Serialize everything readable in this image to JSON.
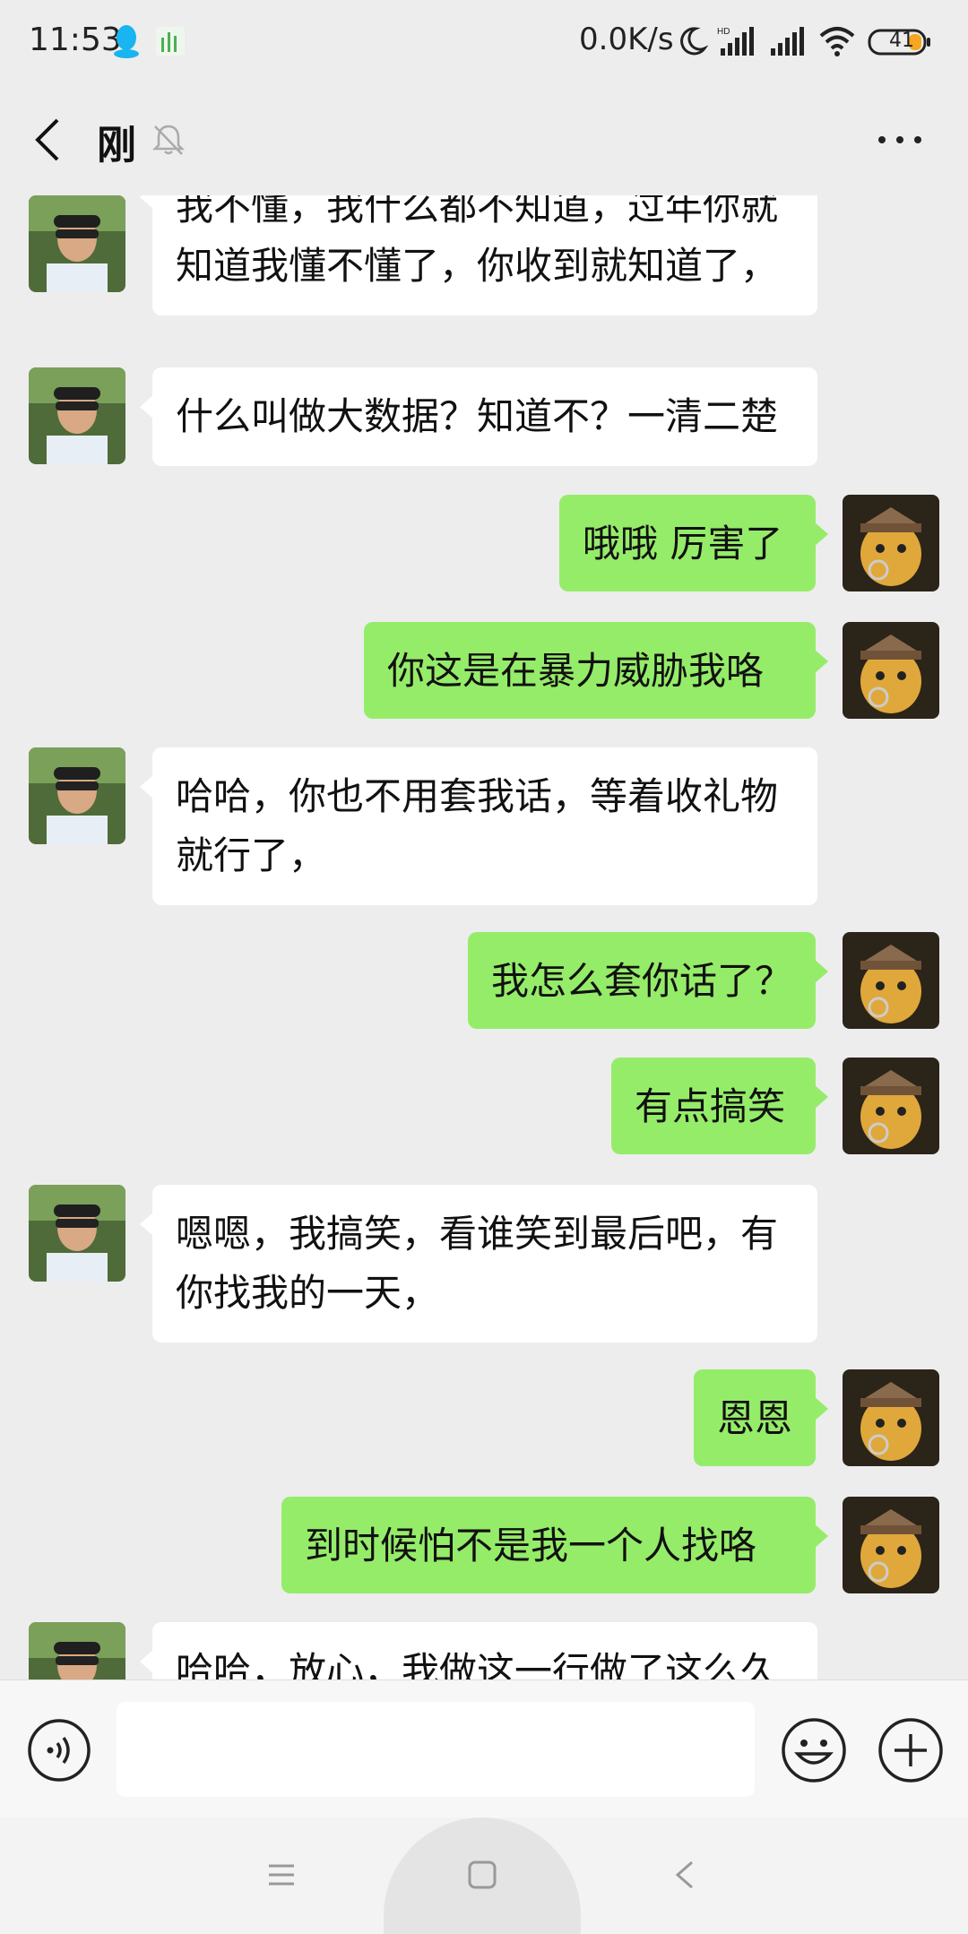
{
  "status_bar": {
    "time": "11:53",
    "net_speed": "0.0K/s",
    "battery": "41",
    "icons": [
      "qq-icon",
      "app-icon",
      "moon-icon",
      "hd-signal-icon",
      "signal-icon",
      "wifi-icon",
      "battery-icon"
    ]
  },
  "header": {
    "title": "刚",
    "back_icon": "back-arrow-icon",
    "mute_icon": "mute-bell-icon",
    "more_icon": "more-icon"
  },
  "messages": [
    {
      "side": "in",
      "text": "我不懂，我什么都不知道，过年你就知道我懂不懂了，你收到就知道了，"
    },
    {
      "side": "in",
      "text": "什么叫做大数据？知道不？一清二楚"
    },
    {
      "side": "out",
      "text": "哦哦 厉害了"
    },
    {
      "side": "out",
      "text": "你这是在暴力威胁我咯"
    },
    {
      "side": "in",
      "text": "哈哈，你也不用套我话，等着收礼物就行了，"
    },
    {
      "side": "out",
      "text": "我怎么套你话了？"
    },
    {
      "side": "out",
      "text": "有点搞笑"
    },
    {
      "side": "in",
      "text": "嗯嗯，我搞笑，看谁笑到最后吧，有你找我的一天，"
    },
    {
      "side": "out",
      "text": "恩恩"
    },
    {
      "side": "out",
      "text": "到时候怕不是我一个人找咯"
    },
    {
      "side": "in",
      "text": "哈哈，放心，我做这一行做了这么久"
    }
  ],
  "input_bar": {
    "placeholder": "",
    "icons": [
      "voice-icon",
      "emoji-icon",
      "plus-icon"
    ]
  },
  "nav_bar": {
    "icons": [
      "menu-icon",
      "home-icon",
      "back-icon"
    ]
  },
  "colors": {
    "background": "#ededed",
    "incoming_bubble": "#ffffff",
    "outgoing_bubble": "#95ec69"
  }
}
